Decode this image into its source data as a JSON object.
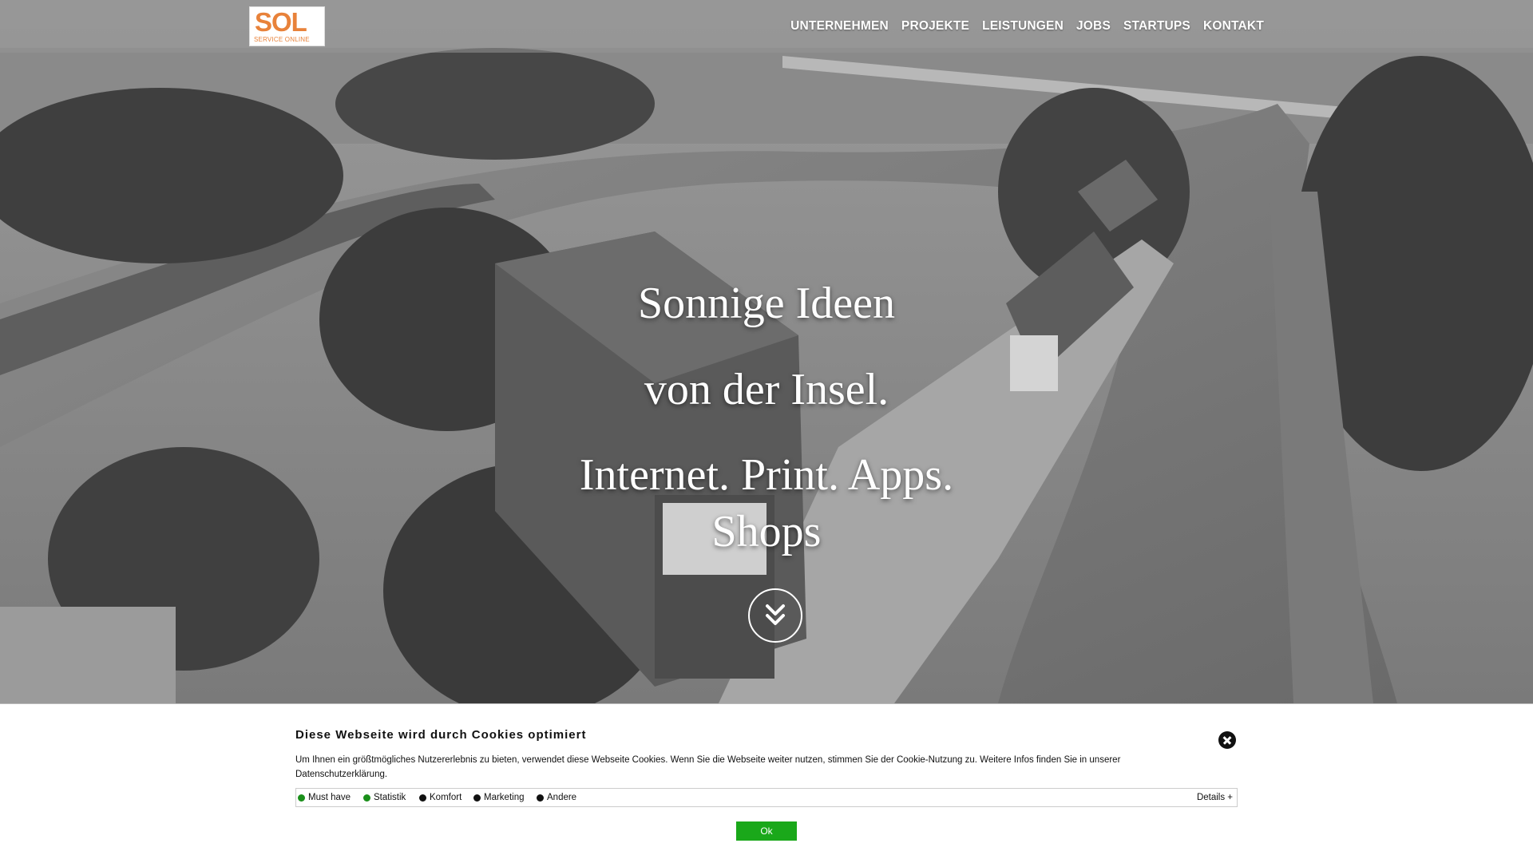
{
  "brand": {
    "logo_text": "SOL",
    "logo_subtitle": "SERVICE ONLINE",
    "accent": "#e8823a"
  },
  "nav": {
    "items": [
      {
        "label": "UNTERNEHMEN"
      },
      {
        "label": "PROJEKTE"
      },
      {
        "label": "LEISTUNGEN"
      },
      {
        "label": "JOBS"
      },
      {
        "label": "STARTUPS"
      },
      {
        "label": "KONTAKT"
      }
    ]
  },
  "hero": {
    "line1": "Sonnige Ideen",
    "line2": "von der Insel.",
    "line3": "Internet. Print. Apps.",
    "line4": "Shops",
    "scroll_icon": "double-chevron-down-icon"
  },
  "cookie_banner": {
    "title": "Diese Webseite wird durch Cookies optimiert",
    "text": "Um Ihnen ein größtmögliches Nutzererlebnis zu bieten, verwendet diese Webseite Cookies. Wenn Sie die Webseite weiter nutzen, stimmen Sie der Cookie-Nutzung zu. Weitere Infos finden Sie in unserer Datenschutzerklärung.",
    "categories": [
      {
        "label": "Must have",
        "color": "#1a8f1a"
      },
      {
        "label": "Statistik",
        "color": "#1a8f1a"
      },
      {
        "label": "Komfort",
        "color": "#111111"
      },
      {
        "label": "Marketing",
        "color": "#111111"
      },
      {
        "label": "Andere",
        "color": "#111111"
      }
    ],
    "details_label": "Details +",
    "ok_label": "Ok",
    "ok_color": "#1aa81a"
  }
}
